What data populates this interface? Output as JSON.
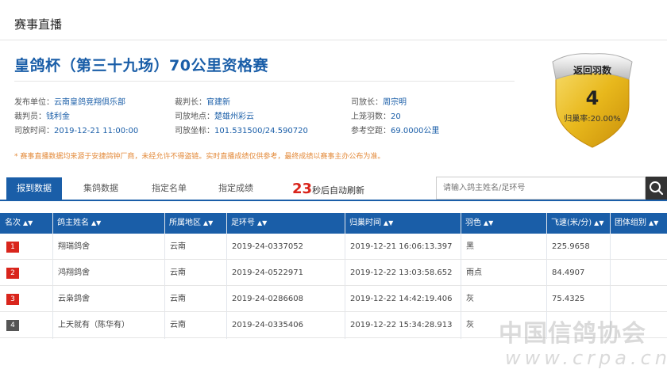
{
  "section_title": "赛事直播",
  "race_title": "皇鸽杯（第三十九场）70公里资格赛",
  "info": {
    "organizer_label": "发布单位：",
    "organizer": "云南皇鸽竞翔俱乐部",
    "judge_label": "裁判长：",
    "judge": "官建新",
    "director_label": "司放长：",
    "director": "周宗明",
    "referee_label": "裁判员：",
    "referee": "钱利金",
    "release_place_label": "司放地点：",
    "release_place": "楚雄州彩云",
    "birds_label": "上笼羽数：",
    "birds": "20",
    "release_time_label": "司放时间：",
    "release_time": "2019-12-21 11:00:00",
    "coords_label": "司放坐标：",
    "coords": "101.531500/24.590720",
    "distance_label": "参考空距：",
    "distance": "69.0000公里"
  },
  "notice": "* 赛事直播数据均来源于安捷鸽钟厂商，未经允许不得盗链。实时直播成绩仅供参考，最终成绩以赛事主办公布为准。",
  "badge": {
    "label": "返回羽数",
    "count": "4",
    "rate": "归巢率:20.00%",
    "gold": "#e8b81c",
    "silver": "#c9c9c9"
  },
  "tabs": [
    {
      "label": "报到数据",
      "active": true
    },
    {
      "label": "集鸽数据",
      "active": false
    },
    {
      "label": "指定名单",
      "active": false
    },
    {
      "label": "指定成绩",
      "active": false
    }
  ],
  "refresh": {
    "seconds": "23",
    "suffix": "秒后自动刷新"
  },
  "search": {
    "placeholder": "请输入鸽主姓名/足环号",
    "icon": "search-icon"
  },
  "table": {
    "headers": [
      "名次",
      "鸽主姓名",
      "所属地区",
      "足环号",
      "归巢时间",
      "羽色",
      "飞速(米/分)",
      "团体组别"
    ],
    "rows": [
      {
        "rank": "1",
        "owner": "翔瑞鸽舍",
        "region": "云南",
        "ring": "2019-24-0337052",
        "time": "2019-12-21 16:06:13.397",
        "color": "黑",
        "speed": "225.9658",
        "group": "",
        "rank_color": "#d9251c"
      },
      {
        "rank": "2",
        "owner": "鸿翔鸽舍",
        "region": "云南",
        "ring": "2019-24-0522971",
        "time": "2019-12-22 13:03:58.652",
        "color": "雨点",
        "speed": "84.4907",
        "group": "",
        "rank_color": "#d9251c"
      },
      {
        "rank": "3",
        "owner": "云枭鸽舍",
        "region": "云南",
        "ring": "2019-24-0286608",
        "time": "2019-12-22 14:42:19.406",
        "color": "灰",
        "speed": "75.4325",
        "group": "",
        "rank_color": "#d9251c"
      },
      {
        "rank": "4",
        "owner": "上天就有（陈华有）",
        "region": "云南",
        "ring": "2019-24-0335406",
        "time": "2019-12-22 15:34:28.913",
        "color": "灰",
        "speed": "",
        "group": "",
        "rank_color": "#555555"
      }
    ]
  },
  "watermark": {
    "line1": "中国信鸽协会",
    "line2": "www.crpa.cn"
  },
  "colors": {
    "primary": "#1a5ea8",
    "accent": "#d9251c",
    "notice": "#e38a3a"
  }
}
